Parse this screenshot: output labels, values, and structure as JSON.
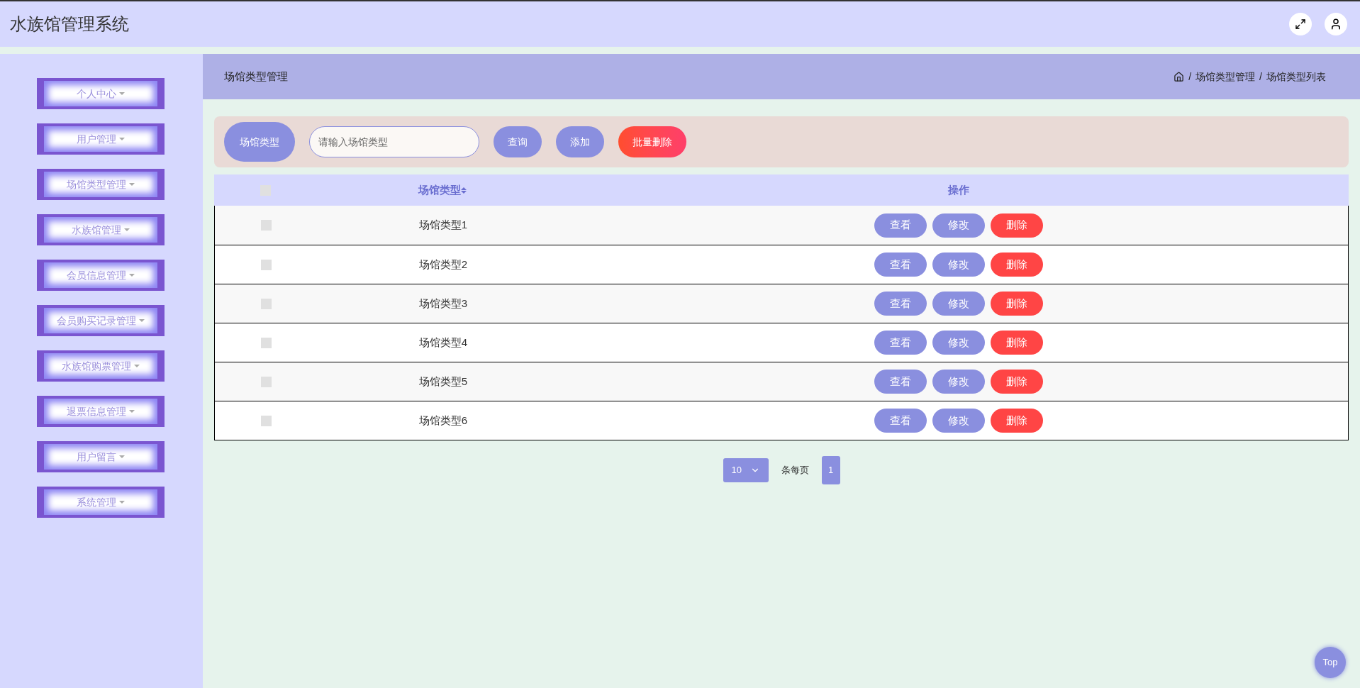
{
  "header": {
    "title": "水族馆管理系统"
  },
  "sidebar": {
    "items": [
      {
        "label": "个人中心"
      },
      {
        "label": "用户管理"
      },
      {
        "label": "场馆类型管理"
      },
      {
        "label": "水族馆管理"
      },
      {
        "label": "会员信息管理"
      },
      {
        "label": "会员购买记录管理"
      },
      {
        "label": "水族馆购票管理"
      },
      {
        "label": "退票信息管理"
      },
      {
        "label": "用户留言"
      },
      {
        "label": "系统管理"
      }
    ]
  },
  "page_header": {
    "title": "场馆类型管理",
    "breadcrumb": [
      {
        "separator": "/",
        "label": "场馆类型管理"
      },
      {
        "separator": "/",
        "label": "场馆类型列表"
      }
    ]
  },
  "filter": {
    "label": "场馆类型",
    "placeholder": "请输入场馆类型",
    "buttons": [
      {
        "label": "查询",
        "kind": "primary"
      },
      {
        "label": "添加",
        "kind": "primary"
      },
      {
        "label": "批量删除",
        "kind": "danger"
      }
    ]
  },
  "table": {
    "columns": [
      "场馆类型",
      "操作"
    ],
    "header_checked": false,
    "rows": [
      {
        "checked": false,
        "type": "场馆类型1",
        "actions": [
          {
            "label": "查看",
            "kind": "primary"
          },
          {
            "label": "修改",
            "kind": "primary"
          },
          {
            "label": "删除",
            "kind": "danger"
          }
        ]
      },
      {
        "checked": false,
        "type": "场馆类型2",
        "actions": [
          {
            "label": "查看",
            "kind": "primary"
          },
          {
            "label": "修改",
            "kind": "primary"
          },
          {
            "label": "删除",
            "kind": "danger"
          }
        ]
      },
      {
        "checked": false,
        "type": "场馆类型3",
        "actions": [
          {
            "label": "查看",
            "kind": "primary"
          },
          {
            "label": "修改",
            "kind": "primary"
          },
          {
            "label": "删除",
            "kind": "danger"
          }
        ]
      },
      {
        "checked": false,
        "type": "场馆类型4",
        "actions": [
          {
            "label": "查看",
            "kind": "primary"
          },
          {
            "label": "修改",
            "kind": "primary"
          },
          {
            "label": "删除",
            "kind": "danger"
          }
        ]
      },
      {
        "checked": false,
        "type": "场馆类型5",
        "actions": [
          {
            "label": "查看",
            "kind": "primary"
          },
          {
            "label": "修改",
            "kind": "primary"
          },
          {
            "label": "删除",
            "kind": "danger"
          }
        ]
      },
      {
        "checked": false,
        "type": "场馆类型6",
        "actions": [
          {
            "label": "查看",
            "kind": "primary"
          },
          {
            "label": "修改",
            "kind": "primary"
          },
          {
            "label": "删除",
            "kind": "danger"
          }
        ]
      }
    ]
  },
  "pagination": {
    "page_size": "10",
    "page_size_label": "条每页",
    "pages": [
      {
        "label": "1",
        "selected": true
      }
    ]
  },
  "back_to_top": "Top"
}
